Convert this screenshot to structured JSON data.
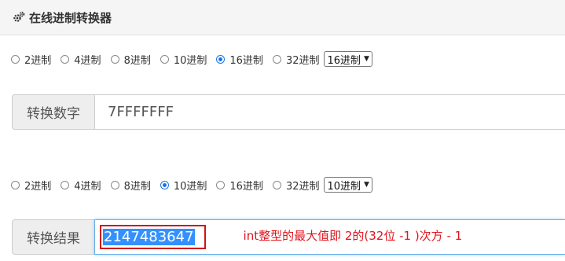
{
  "header": {
    "title": "在线进制转换器",
    "icon": "gears-icon"
  },
  "input_section": {
    "radio_options": [
      "2进制",
      "4进制",
      "8进制",
      "10进制",
      "16进制",
      "32进制"
    ],
    "selected_index": 4,
    "select_value": "16进制",
    "addon_label": "转换数字",
    "value": "7FFFFFFF"
  },
  "output_section": {
    "radio_options": [
      "2进制",
      "4进制",
      "8进制",
      "10进制",
      "16进制",
      "32进制"
    ],
    "selected_index": 3,
    "select_value": "10进制",
    "addon_label": "转换结果",
    "value": "2147483647"
  },
  "annotation": {
    "text": "int整型的最大值即 2的(32位 -1 )次方 - 1",
    "color": "#e0141e"
  },
  "colors": {
    "accent": "#1a73e8",
    "highlight": "#3390ff",
    "annotation_border": "#d0121b"
  }
}
